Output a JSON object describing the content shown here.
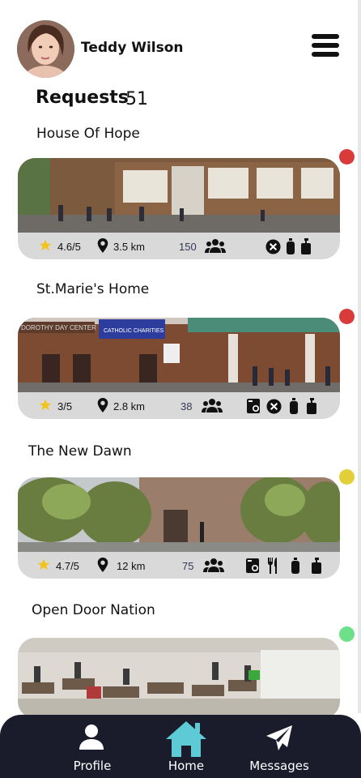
{
  "user": {
    "name": "Teddy Wilson"
  },
  "requests": {
    "label": "Requests",
    "count": "51"
  },
  "places": [
    {
      "name": "House Of Hope",
      "rating": "4.6/5",
      "distance": "3.5 km",
      "people": "150",
      "status_color": "#d93b3b",
      "amenities": [
        "no-entry-icon",
        "bottle-icon",
        "soap-icon"
      ]
    },
    {
      "name": "St.Marie's Home",
      "rating": "3/5",
      "distance": "2.8 km",
      "people": "38",
      "status_color": "#d93b3b",
      "amenities": [
        "laundry-icon",
        "no-entry-icon",
        "bottle-icon",
        "soap-icon"
      ]
    },
    {
      "name": "The New Dawn",
      "rating": "4.7/5",
      "distance": "12 km",
      "people": "75",
      "status_color": "#e3cf3a",
      "amenities": [
        "laundry-icon",
        "utensils-icon",
        "bottle-icon",
        "soap-icon"
      ]
    },
    {
      "name": "Open Door Nation",
      "status_color": "#6fe08a"
    }
  ],
  "photo_signs": {
    "dorothy_day": "DOROTHY DAY CENTER",
    "banner": "CATHOLIC CHARITIES"
  },
  "nav": {
    "profile": "Profile",
    "home": "Home",
    "messages": "Messages",
    "active_color": "#5ecad6"
  }
}
